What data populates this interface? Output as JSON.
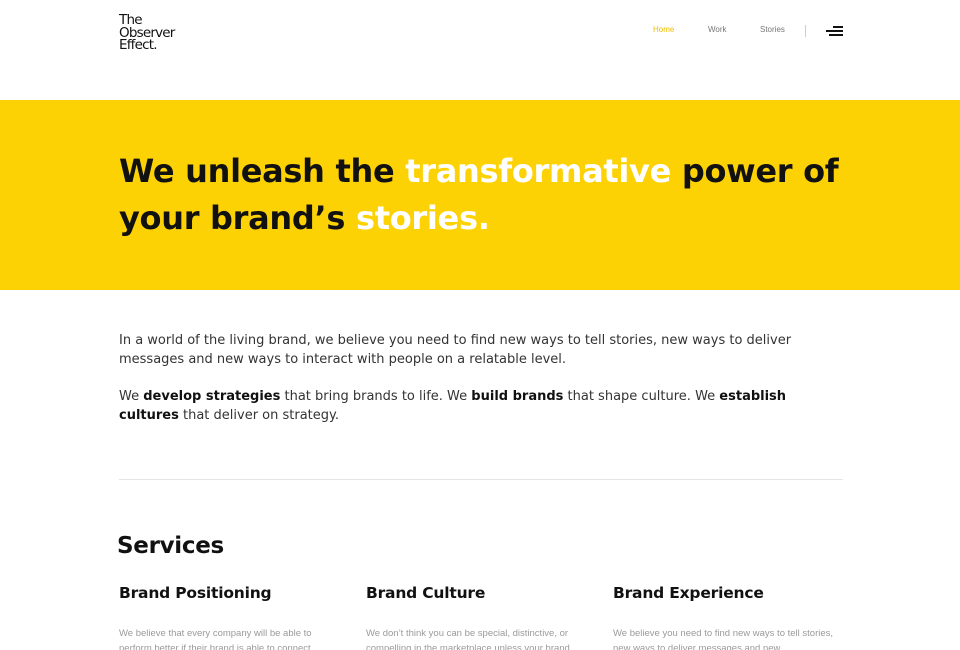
{
  "logo": {
    "line1": "The",
    "line2": "Observer",
    "line3": "Effect."
  },
  "nav": {
    "home": "Home",
    "work": "Work",
    "stories": "Stories",
    "active": "Home",
    "menu_icon": "hamburger-menu-icon"
  },
  "hero": {
    "part1": "We unleash the ",
    "highlight1": "transformative",
    "part2": " power of your brand’s ",
    "highlight2": "stories."
  },
  "intro": {
    "p1": "In a world of the living brand, we believe you need to find new ways to tell stories, new ways to deliver messages and new ways to interact with people on a relatable level.",
    "p2": {
      "t1": "We ",
      "b1": "develop strategies",
      "t2": " that bring brands to life. We ",
      "b2": "build brands",
      "t3": " that shape culture. We ",
      "b3": "establish cultures",
      "t4": " that deliver on strategy."
    }
  },
  "services": {
    "title": "Services",
    "items": [
      {
        "title": "Brand Positioning",
        "text": "We believe that every company will be able to perform better if their brand is able to connect"
      },
      {
        "title": "Brand Culture",
        "text": "We don’t think you can be special, distinctive, or compelling in the marketplace unless your brand"
      },
      {
        "title": "Brand Experience",
        "text": "We believe you need to find new ways to tell stories, new ways to deliver messages and new"
      }
    ]
  },
  "colors": {
    "accent_yellow": "#fdd205",
    "nav_active": "#f0bd00",
    "text_dark": "#111111",
    "muted_text": "#9a9a9a"
  }
}
